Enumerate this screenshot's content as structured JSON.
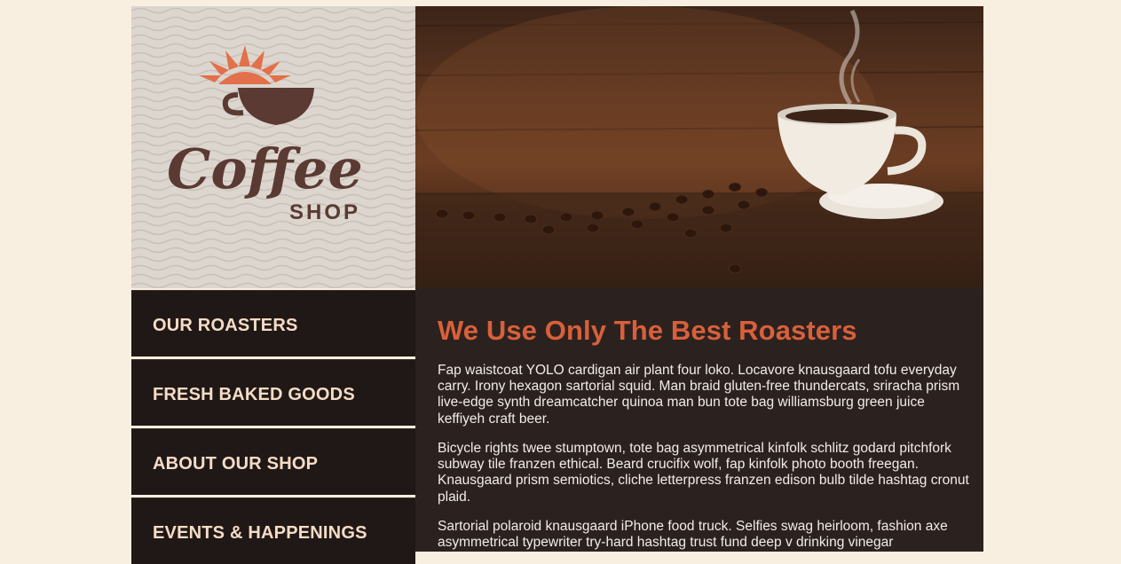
{
  "logo": {
    "script_text": "Coffee",
    "subtitle_text": "SHOP",
    "icon": "coffee-cup-sunburst-icon",
    "colors": {
      "cup": "#5a3a33",
      "sun": "#e2704a",
      "panel": "#dcd6cf"
    }
  },
  "hero": {
    "description_icon": "coffee-cup-beans-photo"
  },
  "nav": {
    "items": [
      {
        "label": "OUR ROASTERS"
      },
      {
        "label": "FRESH BAKED GOODS"
      },
      {
        "label": "ABOUT OUR SHOP"
      },
      {
        "label": "EVENTS & HAPPENINGS"
      }
    ]
  },
  "content": {
    "heading": "We Use Only The Best Roasters",
    "paragraphs": [
      "Fap waistcoat YOLO cardigan air plant four loko. Locavore knausgaard tofu everyday carry. Irony hexagon sartorial squid. Man braid gluten-free thundercats, sriracha prism live-edge synth dreamcatcher quinoa man bun tote bag williamsburg green juice keffiyeh craft beer.",
      "Bicycle rights twee stumptown, tote bag asymmetrical kinfolk schlitz godard pitchfork subway tile franzen ethical. Beard crucifix wolf, fap kinfolk photo booth freegan. Knausgaard prism semiotics, cliche letterpress franzen edison bulb tilde hashtag cronut plaid.",
      "Sartorial polaroid knausgaard iPhone food truck. Selfies swag heirloom, fashion axe asymmetrical typewriter try-hard hashtag trust fund deep v drinking vinegar"
    ]
  },
  "colors": {
    "background": "#f9efe0",
    "nav_bg": "#201816",
    "nav_text": "#f5dcc6",
    "content_bg": "#2b2220",
    "heading": "#d9603a",
    "body_text": "#f2ece6"
  }
}
